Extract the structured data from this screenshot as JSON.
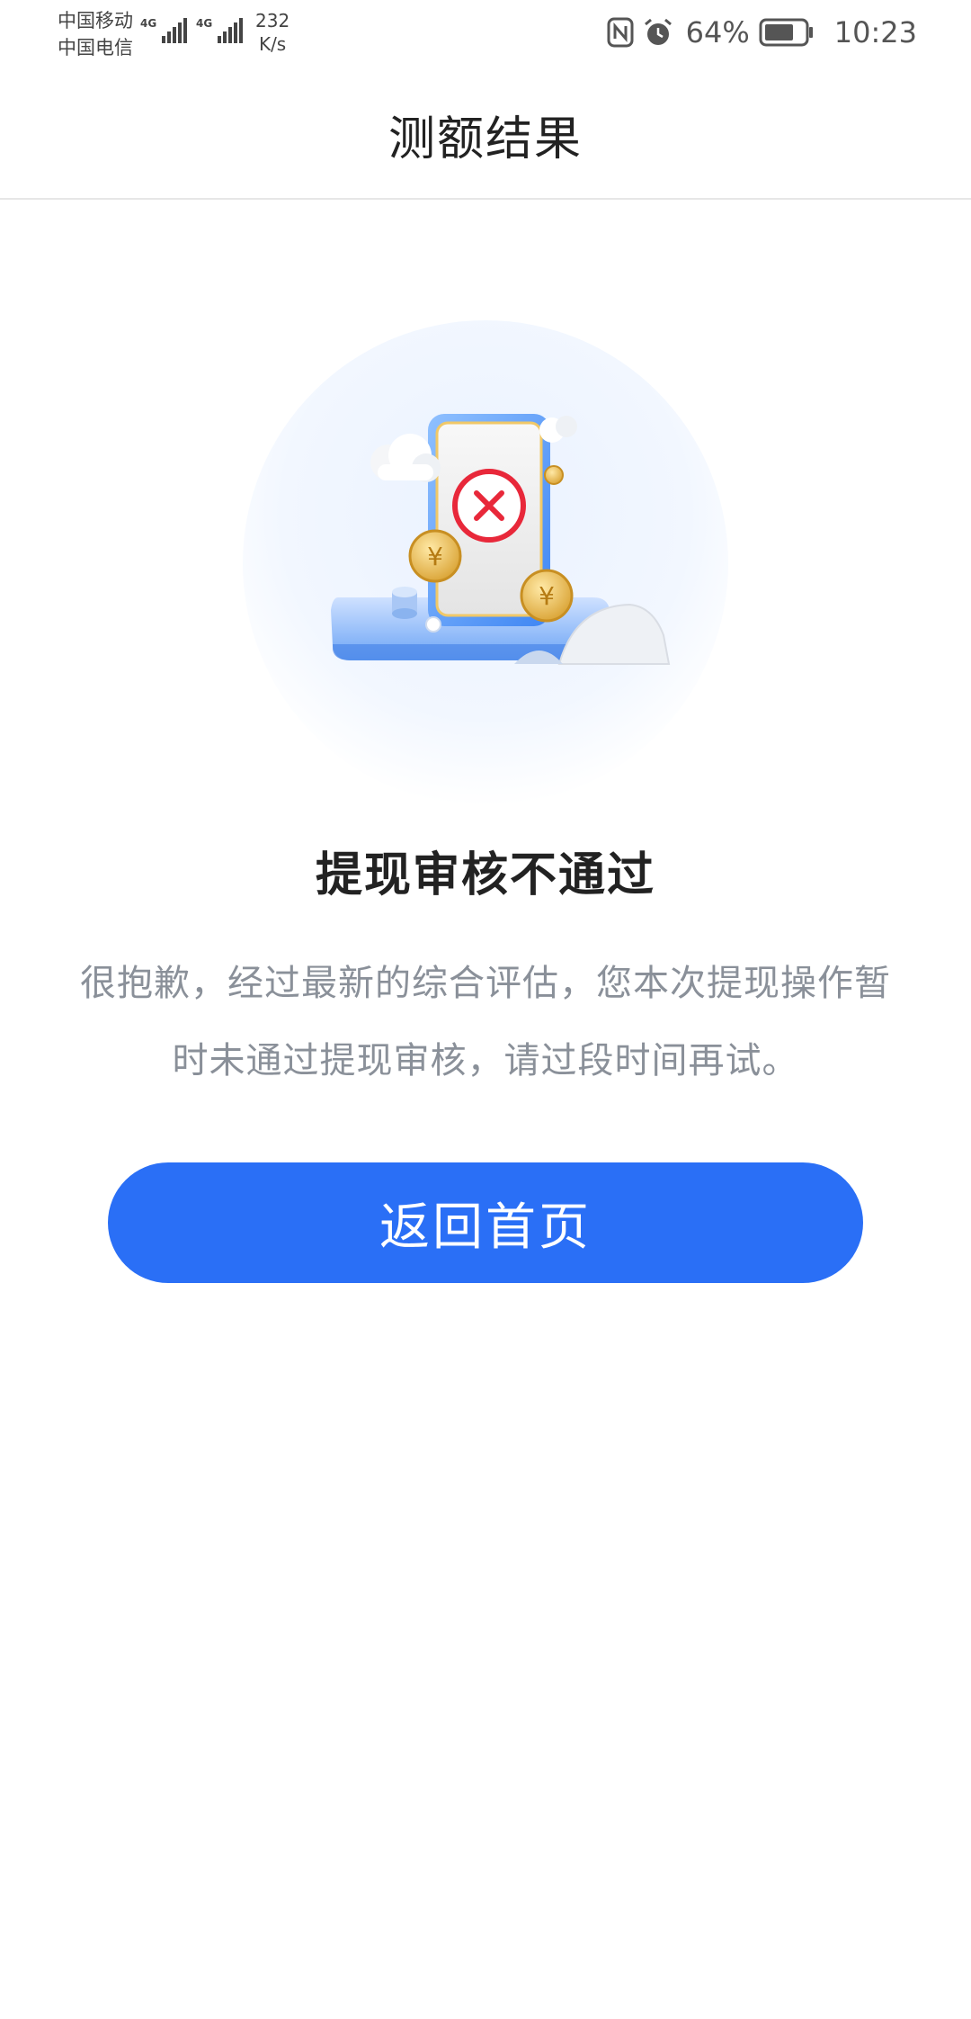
{
  "status_bar": {
    "carrier_1": "中国移动",
    "carrier_2": "中国电信",
    "signal_1_type": "4G",
    "signal_2_type": "4G",
    "net_speed_value": "232",
    "net_speed_unit": "K/s",
    "battery_percent": "64%",
    "time": "10:23",
    "icons": [
      "nfc-icon",
      "alarm-icon",
      "battery-icon"
    ]
  },
  "header": {
    "title": "测额结果"
  },
  "result": {
    "title": "提现审核不通过",
    "description": "很抱歉，经过最新的综合评估，您本次提现操作暂时未通过提现审核，请过段时间再试。"
  },
  "actions": {
    "home_button_label": "返回首页"
  },
  "colors": {
    "accent": "#2a6ff6",
    "error": "#e8283a",
    "coin": "#e7b740"
  }
}
